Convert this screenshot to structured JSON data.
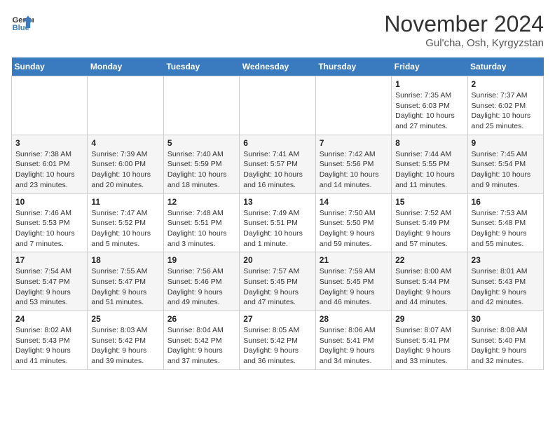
{
  "header": {
    "logo_line1": "General",
    "logo_line2": "Blue",
    "month_year": "November 2024",
    "location": "Gul'cha, Osh, Kyrgyzstan"
  },
  "weekdays": [
    "Sunday",
    "Monday",
    "Tuesday",
    "Wednesday",
    "Thursday",
    "Friday",
    "Saturday"
  ],
  "weeks": [
    [
      {
        "day": "",
        "info": ""
      },
      {
        "day": "",
        "info": ""
      },
      {
        "day": "",
        "info": ""
      },
      {
        "day": "",
        "info": ""
      },
      {
        "day": "",
        "info": ""
      },
      {
        "day": "1",
        "info": "Sunrise: 7:35 AM\nSunset: 6:03 PM\nDaylight: 10 hours\nand 27 minutes."
      },
      {
        "day": "2",
        "info": "Sunrise: 7:37 AM\nSunset: 6:02 PM\nDaylight: 10 hours\nand 25 minutes."
      }
    ],
    [
      {
        "day": "3",
        "info": "Sunrise: 7:38 AM\nSunset: 6:01 PM\nDaylight: 10 hours\nand 23 minutes."
      },
      {
        "day": "4",
        "info": "Sunrise: 7:39 AM\nSunset: 6:00 PM\nDaylight: 10 hours\nand 20 minutes."
      },
      {
        "day": "5",
        "info": "Sunrise: 7:40 AM\nSunset: 5:59 PM\nDaylight: 10 hours\nand 18 minutes."
      },
      {
        "day": "6",
        "info": "Sunrise: 7:41 AM\nSunset: 5:57 PM\nDaylight: 10 hours\nand 16 minutes."
      },
      {
        "day": "7",
        "info": "Sunrise: 7:42 AM\nSunset: 5:56 PM\nDaylight: 10 hours\nand 14 minutes."
      },
      {
        "day": "8",
        "info": "Sunrise: 7:44 AM\nSunset: 5:55 PM\nDaylight: 10 hours\nand 11 minutes."
      },
      {
        "day": "9",
        "info": "Sunrise: 7:45 AM\nSunset: 5:54 PM\nDaylight: 10 hours\nand 9 minutes."
      }
    ],
    [
      {
        "day": "10",
        "info": "Sunrise: 7:46 AM\nSunset: 5:53 PM\nDaylight: 10 hours\nand 7 minutes."
      },
      {
        "day": "11",
        "info": "Sunrise: 7:47 AM\nSunset: 5:52 PM\nDaylight: 10 hours\nand 5 minutes."
      },
      {
        "day": "12",
        "info": "Sunrise: 7:48 AM\nSunset: 5:51 PM\nDaylight: 10 hours\nand 3 minutes."
      },
      {
        "day": "13",
        "info": "Sunrise: 7:49 AM\nSunset: 5:51 PM\nDaylight: 10 hours\nand 1 minute."
      },
      {
        "day": "14",
        "info": "Sunrise: 7:50 AM\nSunset: 5:50 PM\nDaylight: 9 hours\nand 59 minutes."
      },
      {
        "day": "15",
        "info": "Sunrise: 7:52 AM\nSunset: 5:49 PM\nDaylight: 9 hours\nand 57 minutes."
      },
      {
        "day": "16",
        "info": "Sunrise: 7:53 AM\nSunset: 5:48 PM\nDaylight: 9 hours\nand 55 minutes."
      }
    ],
    [
      {
        "day": "17",
        "info": "Sunrise: 7:54 AM\nSunset: 5:47 PM\nDaylight: 9 hours\nand 53 minutes."
      },
      {
        "day": "18",
        "info": "Sunrise: 7:55 AM\nSunset: 5:47 PM\nDaylight: 9 hours\nand 51 minutes."
      },
      {
        "day": "19",
        "info": "Sunrise: 7:56 AM\nSunset: 5:46 PM\nDaylight: 9 hours\nand 49 minutes."
      },
      {
        "day": "20",
        "info": "Sunrise: 7:57 AM\nSunset: 5:45 PM\nDaylight: 9 hours\nand 47 minutes."
      },
      {
        "day": "21",
        "info": "Sunrise: 7:59 AM\nSunset: 5:45 PM\nDaylight: 9 hours\nand 46 minutes."
      },
      {
        "day": "22",
        "info": "Sunrise: 8:00 AM\nSunset: 5:44 PM\nDaylight: 9 hours\nand 44 minutes."
      },
      {
        "day": "23",
        "info": "Sunrise: 8:01 AM\nSunset: 5:43 PM\nDaylight: 9 hours\nand 42 minutes."
      }
    ],
    [
      {
        "day": "24",
        "info": "Sunrise: 8:02 AM\nSunset: 5:43 PM\nDaylight: 9 hours\nand 41 minutes."
      },
      {
        "day": "25",
        "info": "Sunrise: 8:03 AM\nSunset: 5:42 PM\nDaylight: 9 hours\nand 39 minutes."
      },
      {
        "day": "26",
        "info": "Sunrise: 8:04 AM\nSunset: 5:42 PM\nDaylight: 9 hours\nand 37 minutes."
      },
      {
        "day": "27",
        "info": "Sunrise: 8:05 AM\nSunset: 5:42 PM\nDaylight: 9 hours\nand 36 minutes."
      },
      {
        "day": "28",
        "info": "Sunrise: 8:06 AM\nSunset: 5:41 PM\nDaylight: 9 hours\nand 34 minutes."
      },
      {
        "day": "29",
        "info": "Sunrise: 8:07 AM\nSunset: 5:41 PM\nDaylight: 9 hours\nand 33 minutes."
      },
      {
        "day": "30",
        "info": "Sunrise: 8:08 AM\nSunset: 5:40 PM\nDaylight: 9 hours\nand 32 minutes."
      }
    ]
  ]
}
